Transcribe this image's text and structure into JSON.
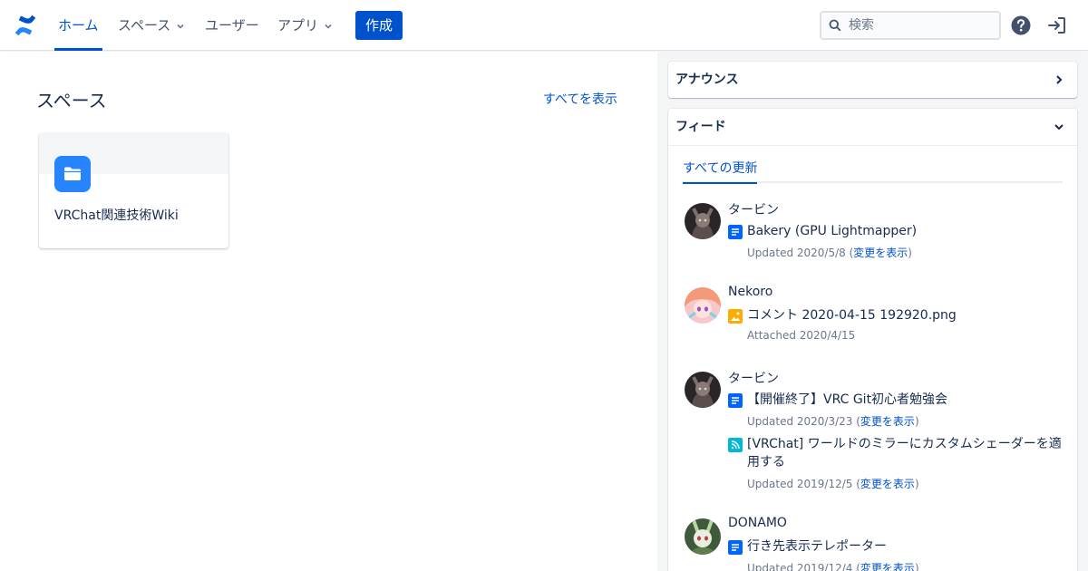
{
  "nav": {
    "logo": "confluence-logo",
    "home": "ホーム",
    "spaces": "スペース",
    "users": "ユーザー",
    "apps": "アプリ",
    "create": "作成",
    "search_placeholder": "検索",
    "help_icon": "help-icon",
    "login_icon": "login-icon"
  },
  "main": {
    "title": "スペース",
    "view_all": "すべてを表示",
    "cards": [
      {
        "name": "VRChat関連技術Wiki",
        "icon": "folder-icon"
      }
    ]
  },
  "sidebar": {
    "announcements": "アナウンス",
    "feed": "フィード",
    "feed_tab": "すべての更新",
    "entries": [
      {
        "author": "タービン",
        "items": [
          {
            "type": "page",
            "title": "Bakery (GPU Lightmapper)",
            "meta_prefix": "Updated 2020/5/8 (",
            "link": "変更を表示",
            "meta_suffix": ")"
          }
        ]
      },
      {
        "author": "Nekoro",
        "items": [
          {
            "type": "image",
            "title": "コメント 2020-04-15 192920.png",
            "meta_prefix": "Attached 2020/4/15"
          }
        ]
      },
      {
        "author": "タービン",
        "items": [
          {
            "type": "page",
            "title": "【開催終了】VRC Git初心者勉強会",
            "meta_prefix": "Updated 2020/3/23 (",
            "link": "変更を表示",
            "meta_suffix": ")"
          },
          {
            "type": "blog",
            "title_line1": "[VRChat] ワールドのミラーにカスタムシェーダーを適",
            "title_line2": "用する",
            "meta_prefix": "Updated 2019/12/5 (",
            "link": "変更を表示",
            "meta_suffix": ")"
          }
        ]
      },
      {
        "author": "DONAMO",
        "items": [
          {
            "type": "page",
            "title": "行き先表示テレポーター",
            "meta_prefix": "Updated 2019/12/4 (",
            "link": "変更を表示",
            "meta_suffix": ")"
          }
        ]
      }
    ]
  },
  "colors": {
    "accent": "#0052cc",
    "page_icon": "#0065ff",
    "image_icon": "#ffab00",
    "blog_icon": "#00b8d9"
  }
}
